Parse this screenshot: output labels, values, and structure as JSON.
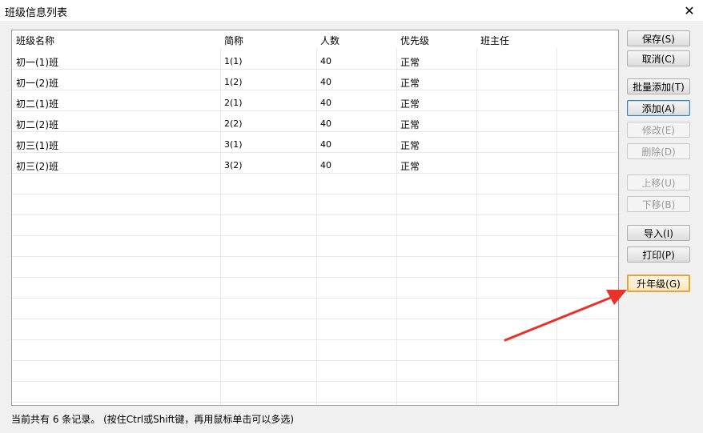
{
  "window": {
    "title": "班级信息列表",
    "close_glyph": "✕"
  },
  "table": {
    "columns": [
      "班级名称",
      "简称",
      "人数",
      "优先级",
      "班主任"
    ],
    "rows": [
      [
        "初一(1)班",
        "1(1)",
        "40",
        "正常",
        ""
      ],
      [
        "初一(2)班",
        "1(2)",
        "40",
        "正常",
        ""
      ],
      [
        "初二(1)班",
        "2(1)",
        "40",
        "正常",
        ""
      ],
      [
        "初二(2)班",
        "2(2)",
        "40",
        "正常",
        ""
      ],
      [
        "初三(1)班",
        "3(1)",
        "40",
        "正常",
        ""
      ],
      [
        "初三(2)班",
        "3(2)",
        "40",
        "正常",
        ""
      ]
    ]
  },
  "buttons": {
    "save": "保存(S)",
    "cancel": "取消(C)",
    "batch_add": "批量添加(T)",
    "add": "添加(A)",
    "modify": "修改(E)",
    "delete": "删除(D)",
    "move_up": "上移(U)",
    "move_down": "下移(B)",
    "import": "导入(I)",
    "print": "打印(P)",
    "upgrade": "升年级(G)"
  },
  "status": {
    "text": "当前共有 6 条记录。 (按住Ctrl或Shift键，再用鼠标单击可以多选)"
  },
  "colors": {
    "annotation_arrow": "#e8322a",
    "highlight_border": "#e8a23b"
  }
}
